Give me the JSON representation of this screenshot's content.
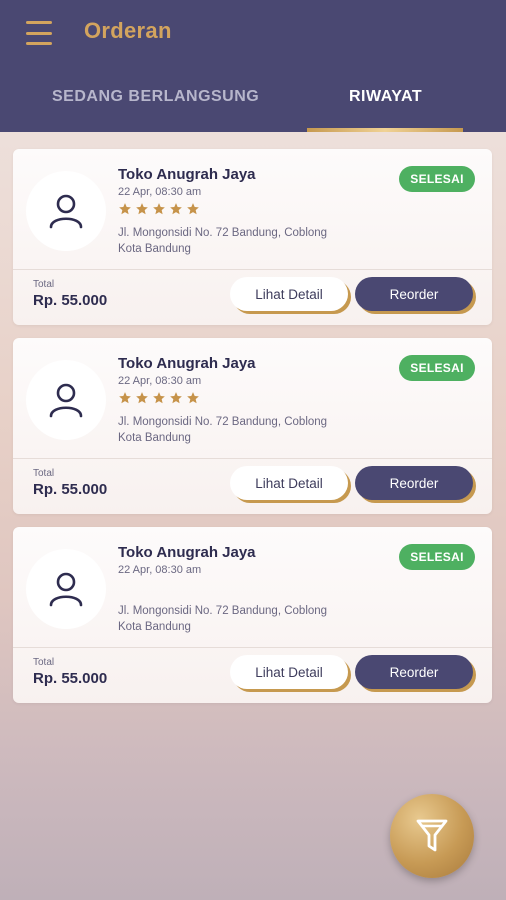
{
  "header": {
    "title": "Orderan",
    "menu_icon": "hamburger-icon"
  },
  "tabs": [
    {
      "label": "SEDANG BERLANGSUNG",
      "active": false
    },
    {
      "label": "RIWAYAT",
      "active": true
    }
  ],
  "colors": {
    "appbar": "#4a4872",
    "accent_gold": "#d3a45e",
    "badge_green": "#4eb061",
    "star": "#c6934a"
  },
  "orders": [
    {
      "store": "Toko Anugrah Jaya",
      "date": "22 Apr, 08:30 am",
      "rating": 5,
      "address_line1": "Jl. Mongonsidi No. 72 Bandung, Coblong",
      "address_line2": "Kota Bandung",
      "status": "SELESAI",
      "total_label": "Total",
      "total_value": "Rp. 55.000",
      "detail_label": "Lihat Detail",
      "reorder_label": "Reorder"
    },
    {
      "store": "Toko Anugrah Jaya",
      "date": "22 Apr, 08:30 am",
      "rating": 5,
      "address_line1": "Jl. Mongonsidi No. 72 Bandung, Coblong",
      "address_line2": "Kota Bandung",
      "status": "SELESAI",
      "total_label": "Total",
      "total_value": "Rp. 55.000",
      "detail_label": "Lihat Detail",
      "reorder_label": "Reorder"
    },
    {
      "store": "Toko Anugrah Jaya",
      "date": "22 Apr, 08:30 am",
      "rating": 0,
      "address_line1": "Jl. Mongonsidi No. 72 Bandung, Coblong",
      "address_line2": "Kota Bandung",
      "status": "SELESAI",
      "total_label": "Total",
      "total_value": "Rp. 55.000",
      "detail_label": "Lihat Detail",
      "reorder_label": "Reorder"
    }
  ],
  "fab": {
    "icon": "filter-icon"
  }
}
